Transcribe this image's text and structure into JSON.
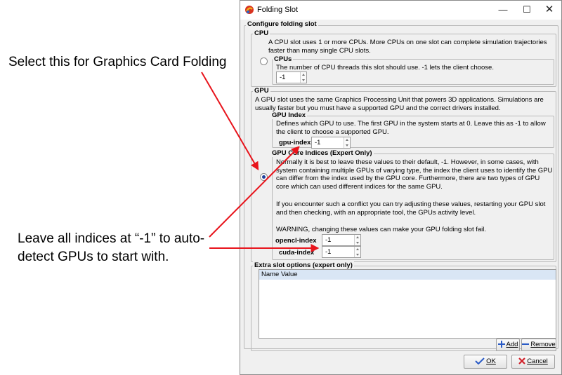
{
  "annotations": {
    "select_text": "Select this for Graphics Card Folding",
    "leave_text": "Leave all indices at “-1” to auto-detect GPUs to start with."
  },
  "window": {
    "title": "Folding Slot",
    "min_label": "—",
    "max_label": "☐",
    "close_label": "✕"
  },
  "dialog": {
    "section_title": "Configure folding slot",
    "cpu": {
      "legend": "CPU",
      "description": "A CPU slot uses 1 or more CPUs.  More CPUs on one slot can complete simulation trajectories faster than many single CPU slots.",
      "cpus_label": "CPUs",
      "cpus_help": "The number of CPU threads this slot should use.  -1 lets the client choose.",
      "cpus_value": "-1"
    },
    "gpu": {
      "legend": "GPU",
      "description": "A GPU slot uses the same Graphics Processing Unit that powers 3D applications.  Simulations are usually faster but you must have a supported GPU and the correct drivers installed.",
      "index": {
        "legend": "GPU Index",
        "help": "Defines which GPU to use.  The first GPU in the system starts at 0.  Leave this as -1 to allow the client to choose a supported GPU.",
        "label": "gpu-index",
        "value": "-1"
      },
      "core": {
        "legend": "GPU Core Indices (Expert Only)",
        "para1": "Normally it is best to leave these values to their default, -1.  However, in some cases, with system containing multiple GPUs of varying type, the index the client uses to identify the GPU can differ from the index used by the GPU core.  Furthermore, there are two types of GPU core which can used different indices for the same GPU.",
        "para2": "If you encounter such a conflict you can try adjusting these values, restarting your GPU slot and then checking, with an appropriate tool, the GPUs activity level.",
        "warning": "WARNING, changing these values can make your GPU folding slot fail.",
        "opencl_label": "opencl-index",
        "opencl_value": "-1",
        "cuda_label": "cuda-index",
        "cuda_value": "-1"
      }
    },
    "extra": {
      "legend": "Extra slot options (expert only)",
      "col_name": "Name",
      "col_value": "Value",
      "add_label": "Add",
      "remove_label": "Remove"
    },
    "ok_label": "OK",
    "cancel_label": "Cancel"
  },
  "colors": {
    "arrow": "#e8141c",
    "selection_header": "#d9e6f5"
  }
}
